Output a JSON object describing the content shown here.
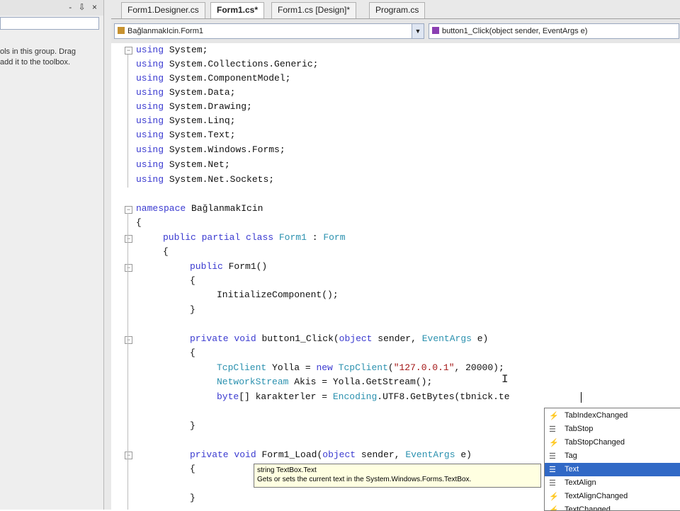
{
  "toolbox": {
    "pin_icons": "- ⇩ ×",
    "message_line1": "ols in this group. Drag",
    "message_line2": "add it to the toolbox."
  },
  "tabs": [
    {
      "label": "Form1.Designer.cs",
      "active": false
    },
    {
      "label": "Form1.cs*",
      "active": true
    },
    {
      "label": "Form1.cs [Design]*",
      "active": false
    },
    {
      "label": "Program.cs",
      "active": false
    }
  ],
  "navbar": {
    "type_combo": "BağlanmakIcin.Form1",
    "member_combo": "button1_Click(object sender, EventArgs e)"
  },
  "code": {
    "u1": "System;",
    "u2": "System.Collections.Generic;",
    "u3": "System.ComponentModel;",
    "u4": "System.Data;",
    "u5": "System.Drawing;",
    "u6": "System.Linq;",
    "u7": "System.Text;",
    "u8": "System.Windows.Forms;",
    "u9": "System.Net;",
    "u10": "System.Net.Sockets;",
    "using_kw": "using",
    "namespace_kw": "namespace",
    "namespace_name": "BağlanmakIcin",
    "open_brace": "{",
    "close_brace": "}",
    "class_public": "public",
    "class_partial": "partial",
    "class_kw": "class",
    "class_name": "Form1",
    "class_colon": ":",
    "class_base": "Form",
    "ctor_public": "public",
    "ctor_name": "Form1()",
    "init_call": "InitializeComponent();",
    "m1_private": "private",
    "m1_void": "void",
    "m1_name": "button1_Click(",
    "m1_object": "object",
    "m1_sender": "sender,",
    "m1_eventargs": "EventArgs",
    "m1_e": "e)",
    "l1_type": "TcpClient",
    "l1_mid": "Yolla =",
    "l1_new": "new",
    "l1_type2": "TcpClient",
    "l1_open": "(",
    "l1_str": "\"127.0.0.1\"",
    "l1_tail": ", 20000);",
    "l2_type": "NetworkStream",
    "l2_tail": "Akis = Yolla.GetStream();",
    "l3_byte": "byte",
    "l3_mid": "[] karakterler =",
    "l3_enc": "Encoding",
    "l3_tail": ".UTF8.GetBytes(tbnick.te",
    "m2_private": "private",
    "m2_void": "void",
    "m2_name": "Form1_Load(",
    "m2_object": "object",
    "m2_sender": "sender,",
    "m2_eventargs": "EventArgs",
    "m2_e": "e)"
  },
  "completion_items": [
    {
      "label": "TabIndexChanged",
      "kind": "event"
    },
    {
      "label": "TabStop",
      "kind": "property"
    },
    {
      "label": "TabStopChanged",
      "kind": "event"
    },
    {
      "label": "Tag",
      "kind": "property"
    },
    {
      "label": "Text",
      "kind": "property",
      "selected": true
    },
    {
      "label": "TextAlign",
      "kind": "property"
    },
    {
      "label": "TextAlignChanged",
      "kind": "event"
    },
    {
      "label": "TextChanged",
      "kind": "event"
    }
  ],
  "tooltip": {
    "line1": "string TextBox.Text",
    "line2": "Gets or sets the current text in the System.Windows.Forms.TextBox."
  },
  "colors": {
    "keyword": "#3a3ad0",
    "type": "#2b91af",
    "string": "#a31515",
    "selection": "#3169c6",
    "change_bar": "#49c149"
  }
}
